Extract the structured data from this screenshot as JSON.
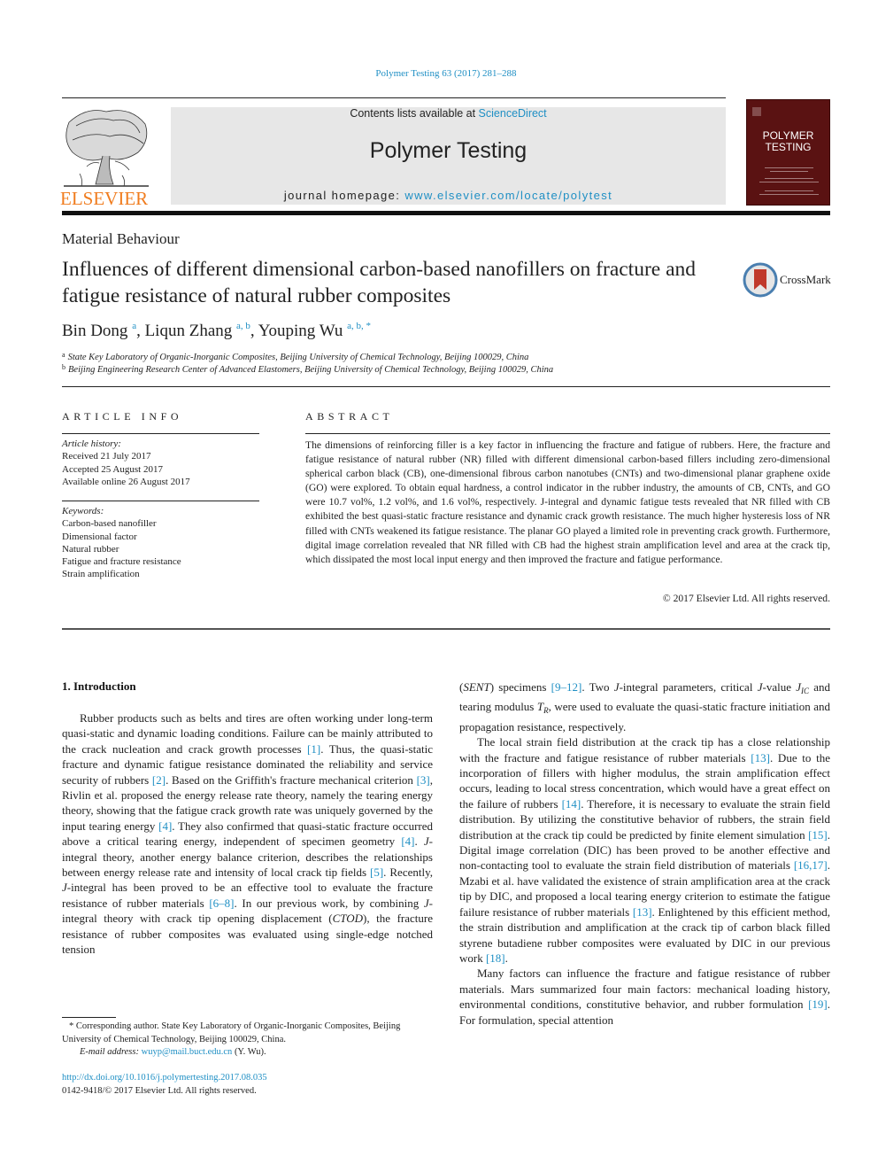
{
  "citation": {
    "text": "Polymer Testing 63 (2017) 281–288"
  },
  "masthead": {
    "contents_prefix": "Contents lists available at ",
    "contents_link": "ScienceDirect",
    "journal_name": "Polymer Testing",
    "homepage_prefix": "journal homepage: ",
    "homepage_url": "www.elsevier.com/locate/polytest",
    "publisher_logo_text": "ELSEVIER",
    "cover_title_line1": "POLYMER",
    "cover_title_line2": "TESTING"
  },
  "article": {
    "section": "Material Behaviour",
    "title": "Influences of different dimensional carbon-based nanofillers on fracture and fatigue resistance of natural rubber composites",
    "crossmark_label": "CrossMark",
    "authors": [
      {
        "name": "Bin Dong",
        "affil": "a"
      },
      {
        "name": "Liqun Zhang",
        "affil": "a, b"
      },
      {
        "name": "Youping Wu",
        "affil": "a, b, *"
      }
    ],
    "affiliations": [
      {
        "key": "a",
        "text": "State Key Laboratory of Organic-Inorganic Composites, Beijing University of Chemical Technology, Beijing 100029, China"
      },
      {
        "key": "b",
        "text": "Beijing Engineering Research Center of Advanced Elastomers, Beijing University of Chemical Technology, Beijing 100029, China"
      }
    ]
  },
  "article_info": {
    "heading": "ARTICLE INFO",
    "history_label": "Article history:",
    "history": [
      "Received 21 July 2017",
      "Accepted 25 August 2017",
      "Available online 26 August 2017"
    ],
    "keywords_label": "Keywords:",
    "keywords": [
      "Carbon-based nanofiller",
      "Dimensional factor",
      "Natural rubber",
      "Fatigue and fracture resistance",
      "Strain amplification"
    ]
  },
  "abstract": {
    "heading": "ABSTRACT",
    "text": "The dimensions of reinforcing filler is a key factor in influencing the fracture and fatigue of rubbers. Here, the fracture and fatigue resistance of natural rubber (NR) filled with different dimensional carbon-based fillers including zero-dimensional spherical carbon black (CB), one-dimensional fibrous carbon nanotubes (CNTs) and two-dimensional planar graphene oxide (GO) were explored. To obtain equal hardness, a control indicator in the rubber industry, the amounts of CB, CNTs, and GO were 10.7 vol%, 1.2 vol%, and 1.6 vol%, respectively. J-integral and dynamic fatigue tests revealed that NR filled with CB exhibited the best quasi-static fracture resistance and dynamic crack growth resistance. The much higher hysteresis loss of NR filled with CNTs weakened its fatigue resistance. The planar GO played a limited role in preventing crack growth. Furthermore, digital image correlation revealed that NR filled with CB had the highest strain amplification level and area at the crack tip, which dissipated the most local input energy and then improved the fracture and fatigue performance.",
    "copyright": "© 2017 Elsevier Ltd. All rights reserved."
  },
  "body": {
    "intro_heading": "1.  Introduction",
    "left_paragraph": [
      {
        "t": "Rubber products such as belts and tires are often working under long-term quasi-static and dynamic loading conditions. Failure can be mainly attributed to the crack nucleation and crack growth processes "
      },
      {
        "ref": "[1]"
      },
      {
        "t": ". Thus, the quasi-static fracture and dynamic fatigue resistance dominated the reliability and service security of rubbers "
      },
      {
        "ref": "[2]"
      },
      {
        "t": ". Based on the Griffith's fracture mechanical criterion "
      },
      {
        "ref": "[3]"
      },
      {
        "t": ", Rivlin et al. proposed the energy release rate theory, namely the tearing energy theory, showing that the fatigue crack growth rate was uniquely governed by the input tearing energy "
      },
      {
        "ref": "[4]"
      },
      {
        "t": ". They also confirmed that quasi-static fracture occurred above a critical tearing energy, independent of specimen geometry "
      },
      {
        "ref": "[4]"
      },
      {
        "t": ". "
      },
      {
        "i": "J"
      },
      {
        "t": "-integral theory, another energy balance criterion, describes the relationships between energy release rate and intensity of local crack tip fields "
      },
      {
        "ref": "[5]"
      },
      {
        "t": ". Recently, "
      },
      {
        "i": "J"
      },
      {
        "t": "-integral has been proved to be an effective tool to evaluate the fracture resistance of rubber materials "
      },
      {
        "ref": "[6–8]"
      },
      {
        "t": ". In our previous work, by combining "
      },
      {
        "i": "J"
      },
      {
        "t": "-integral theory with crack tip opening displacement ("
      },
      {
        "i": "CTOD"
      },
      {
        "t": "), the fracture resistance of rubber composites was evaluated using single-edge notched tension"
      }
    ],
    "right_paragraphs": [
      {
        "indent": false,
        "runs": [
          {
            "t": "("
          },
          {
            "i": "SENT"
          },
          {
            "t": ") specimens "
          },
          {
            "ref": "[9–12]"
          },
          {
            "t": ". Two "
          },
          {
            "i": "J"
          },
          {
            "t": "-integral parameters, critical "
          },
          {
            "i": "J"
          },
          {
            "t": "-value "
          },
          {
            "i": "J"
          },
          {
            "sub": "IC"
          },
          {
            "t": " and tearing modulus "
          },
          {
            "i": "T"
          },
          {
            "sub": "R"
          },
          {
            "t": ", were used to evaluate the quasi-static fracture initiation and propagation resistance, respectively."
          }
        ]
      },
      {
        "indent": true,
        "runs": [
          {
            "t": "The local strain field distribution at the crack tip has a close relationship with the fracture and fatigue resistance of rubber materials "
          },
          {
            "ref": "[13]"
          },
          {
            "t": ". Due to the incorporation of fillers with higher modulus, the strain amplification effect occurs, leading to local stress concentration, which would have a great effect on the failure of rubbers "
          },
          {
            "ref": "[14]"
          },
          {
            "t": ". Therefore, it is necessary to evaluate the strain field distribution. By utilizing the constitutive behavior of rubbers, the strain field distribution at the crack tip could be predicted by finite element simulation "
          },
          {
            "ref": "[15]"
          },
          {
            "t": ". Digital image correlation (DIC) has been proved to be another effective and non-contacting tool to evaluate the strain field distribution of materials "
          },
          {
            "ref": "[16,17]"
          },
          {
            "t": ". Mzabi et al. have validated the existence of strain amplification area at the crack tip by DIC, and proposed a local tearing energy criterion to estimate the fatigue failure resistance of rubber materials "
          },
          {
            "ref": "[13]"
          },
          {
            "t": ". Enlightened by this efficient method, the strain distribution and amplification at the crack tip of carbon black filled styrene butadiene rubber composites were evaluated by DIC in our previous work "
          },
          {
            "ref": "[18]"
          },
          {
            "t": "."
          }
        ]
      },
      {
        "indent": true,
        "runs": [
          {
            "t": "Many factors can influence the fracture and fatigue resistance of rubber materials. Mars summarized four main factors: mechanical loading history, environmental conditions, constitutive behavior, and rubber formulation "
          },
          {
            "ref": "[19]"
          },
          {
            "t": ". For formulation, special attention"
          }
        ]
      }
    ]
  },
  "footnote": {
    "corresponding": "* Corresponding author. State Key Laboratory of Organic-Inorganic Composites, Beijing University of Chemical Technology, Beijing 100029, China.",
    "email_label": "E-mail address: ",
    "email": "wuyp@mail.buct.edu.cn",
    "email_suffix": " (Y. Wu).",
    "doi": "http://dx.doi.org/10.1016/j.polymertesting.2017.08.035",
    "issn": "0142-9418/© 2017 Elsevier Ltd. All rights reserved."
  }
}
